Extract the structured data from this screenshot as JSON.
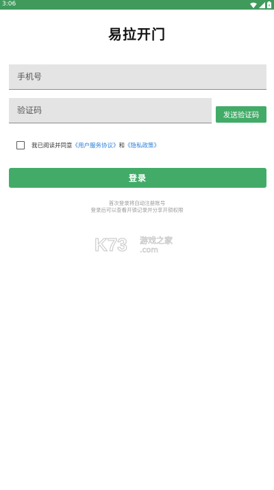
{
  "status_bar": {
    "time": "3:06"
  },
  "title": "易拉开门",
  "phone_input": {
    "placeholder": "手机号"
  },
  "code_input": {
    "placeholder": "验证码"
  },
  "send_code_button": "发送验证码",
  "agreement": {
    "prefix": "我已阅读并同意",
    "user_agreement": "《用户服务协议》",
    "conjunction": "和",
    "privacy_policy": "《隐私政策》"
  },
  "login_button": "登录",
  "hints": {
    "line1": "首次登录将自动注册账号",
    "line2": "登录后可以查看开锁记录并分享开锁权限"
  },
  "watermark": {
    "logo": "K73",
    "text1": "游戏之家",
    "text2": ".com"
  },
  "colors": {
    "accent": "#42ab68",
    "status_bar": "#3f9a5c",
    "link": "#2b7fd6"
  },
  "icons": [
    "wifi-icon",
    "signal-icon",
    "battery-icon"
  ]
}
